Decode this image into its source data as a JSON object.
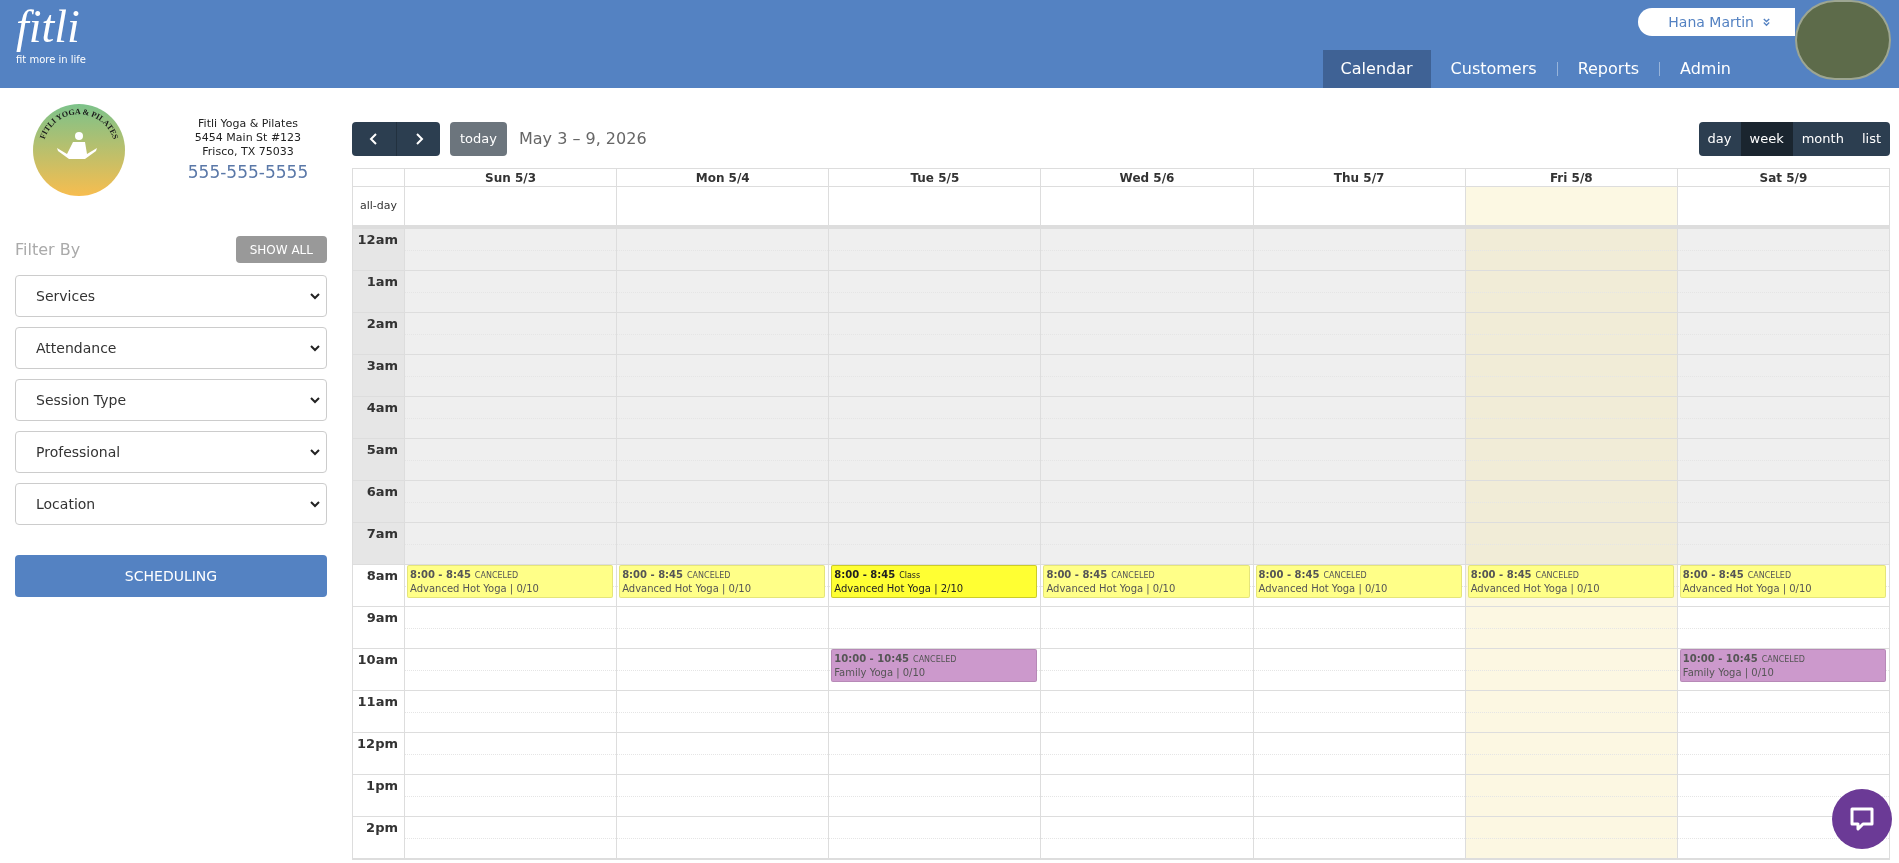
{
  "brand": {
    "name": "fitli",
    "tagline": "fit more in life"
  },
  "user": {
    "name": "Hana Martin"
  },
  "nav": [
    {
      "label": "Calendar",
      "selected": true
    },
    {
      "label": "Customers",
      "selected": false
    },
    {
      "label": "Reports",
      "selected": false
    },
    {
      "label": "Admin",
      "selected": false
    }
  ],
  "studio": {
    "logo_text": "FITLI YOGA & PILATES",
    "name": "Fitli Yoga & Pilates",
    "address": "5454 Main St #123",
    "city": "Frisco, TX 75033",
    "phone": "555-555-5555"
  },
  "filter": {
    "label": "Filter By",
    "show_all": "SHOW ALL",
    "selects": [
      "Services",
      "Attendance",
      "Session Type",
      "Professional",
      "Location"
    ],
    "scheduling": "SCHEDULING"
  },
  "calendar": {
    "today_button": "today",
    "title": "May 3 – 9, 2026",
    "views": [
      {
        "label": "day",
        "selected": false
      },
      {
        "label": "week",
        "selected": true
      },
      {
        "label": "month",
        "selected": false
      },
      {
        "label": "list",
        "selected": false
      }
    ],
    "all_day": "all-day",
    "days": [
      {
        "label": "Sun 5/3",
        "today": false
      },
      {
        "label": "Mon 5/4",
        "today": false
      },
      {
        "label": "Tue 5/5",
        "today": false
      },
      {
        "label": "Wed 5/6",
        "today": false
      },
      {
        "label": "Thu 5/7",
        "today": false
      },
      {
        "label": "Fri 5/8",
        "today": true
      },
      {
        "label": "Sat 5/9",
        "today": false
      }
    ],
    "hours": [
      {
        "label": "12am",
        "off": true
      },
      {
        "label": "1am",
        "off": true
      },
      {
        "label": "2am",
        "off": true
      },
      {
        "label": "3am",
        "off": true
      },
      {
        "label": "4am",
        "off": true
      },
      {
        "label": "5am",
        "off": true
      },
      {
        "label": "6am",
        "off": true
      },
      {
        "label": "7am",
        "off": true
      },
      {
        "label": "8am",
        "off": false,
        "slots": [
          {
            "time": "8:00 - 8:45",
            "tag": "CANCELED",
            "title": "Advanced Hot Yoga | 0/10",
            "color": "#ffff88",
            "canceled": true
          },
          {
            "time": "8:00 - 8:45",
            "tag": "CANCELED",
            "title": "Advanced Hot Yoga | 0/10",
            "color": "#ffff88",
            "canceled": true
          },
          {
            "time": "8:00 - 8:45",
            "tag": "Class",
            "title": "Advanced Hot Yoga | 2/10",
            "color": "#ffff33",
            "canceled": false
          },
          {
            "time": "8:00 - 8:45",
            "tag": "CANCELED",
            "title": "Advanced Hot Yoga | 0/10",
            "color": "#ffff88",
            "canceled": true
          },
          {
            "time": "8:00 - 8:45",
            "tag": "CANCELED",
            "title": "Advanced Hot Yoga | 0/10",
            "color": "#ffff88",
            "canceled": true
          },
          {
            "time": "8:00 - 8:45",
            "tag": "CANCELED",
            "title": "Advanced Hot Yoga | 0/10",
            "color": "#ffff88",
            "canceled": true
          },
          {
            "time": "8:00 - 8:45",
            "tag": "CANCELED",
            "title": "Advanced Hot Yoga | 0/10",
            "color": "#ffff88",
            "canceled": true
          }
        ]
      },
      {
        "label": "9am",
        "off": false
      },
      {
        "label": "10am",
        "off": false,
        "slots": [
          {
            "kind": "empty"
          },
          {
            "kind": "empty"
          },
          {
            "time": "10:00 - 10:45",
            "tag": "CANCELED",
            "title": "Family Yoga | 0/10",
            "color": "#cc99cc",
            "canceled": true
          },
          {
            "kind": "empty"
          },
          {
            "kind": "empty"
          },
          {
            "kind": "empty"
          },
          {
            "time": "10:00 - 10:45",
            "tag": "CANCELED",
            "title": "Family Yoga | 0/10",
            "color": "#cc99cc",
            "canceled": true
          }
        ]
      },
      {
        "label": "11am",
        "off": false
      },
      {
        "label": "12pm",
        "off": false
      },
      {
        "label": "1pm",
        "off": false
      },
      {
        "label": "2pm",
        "off": false
      }
    ]
  }
}
